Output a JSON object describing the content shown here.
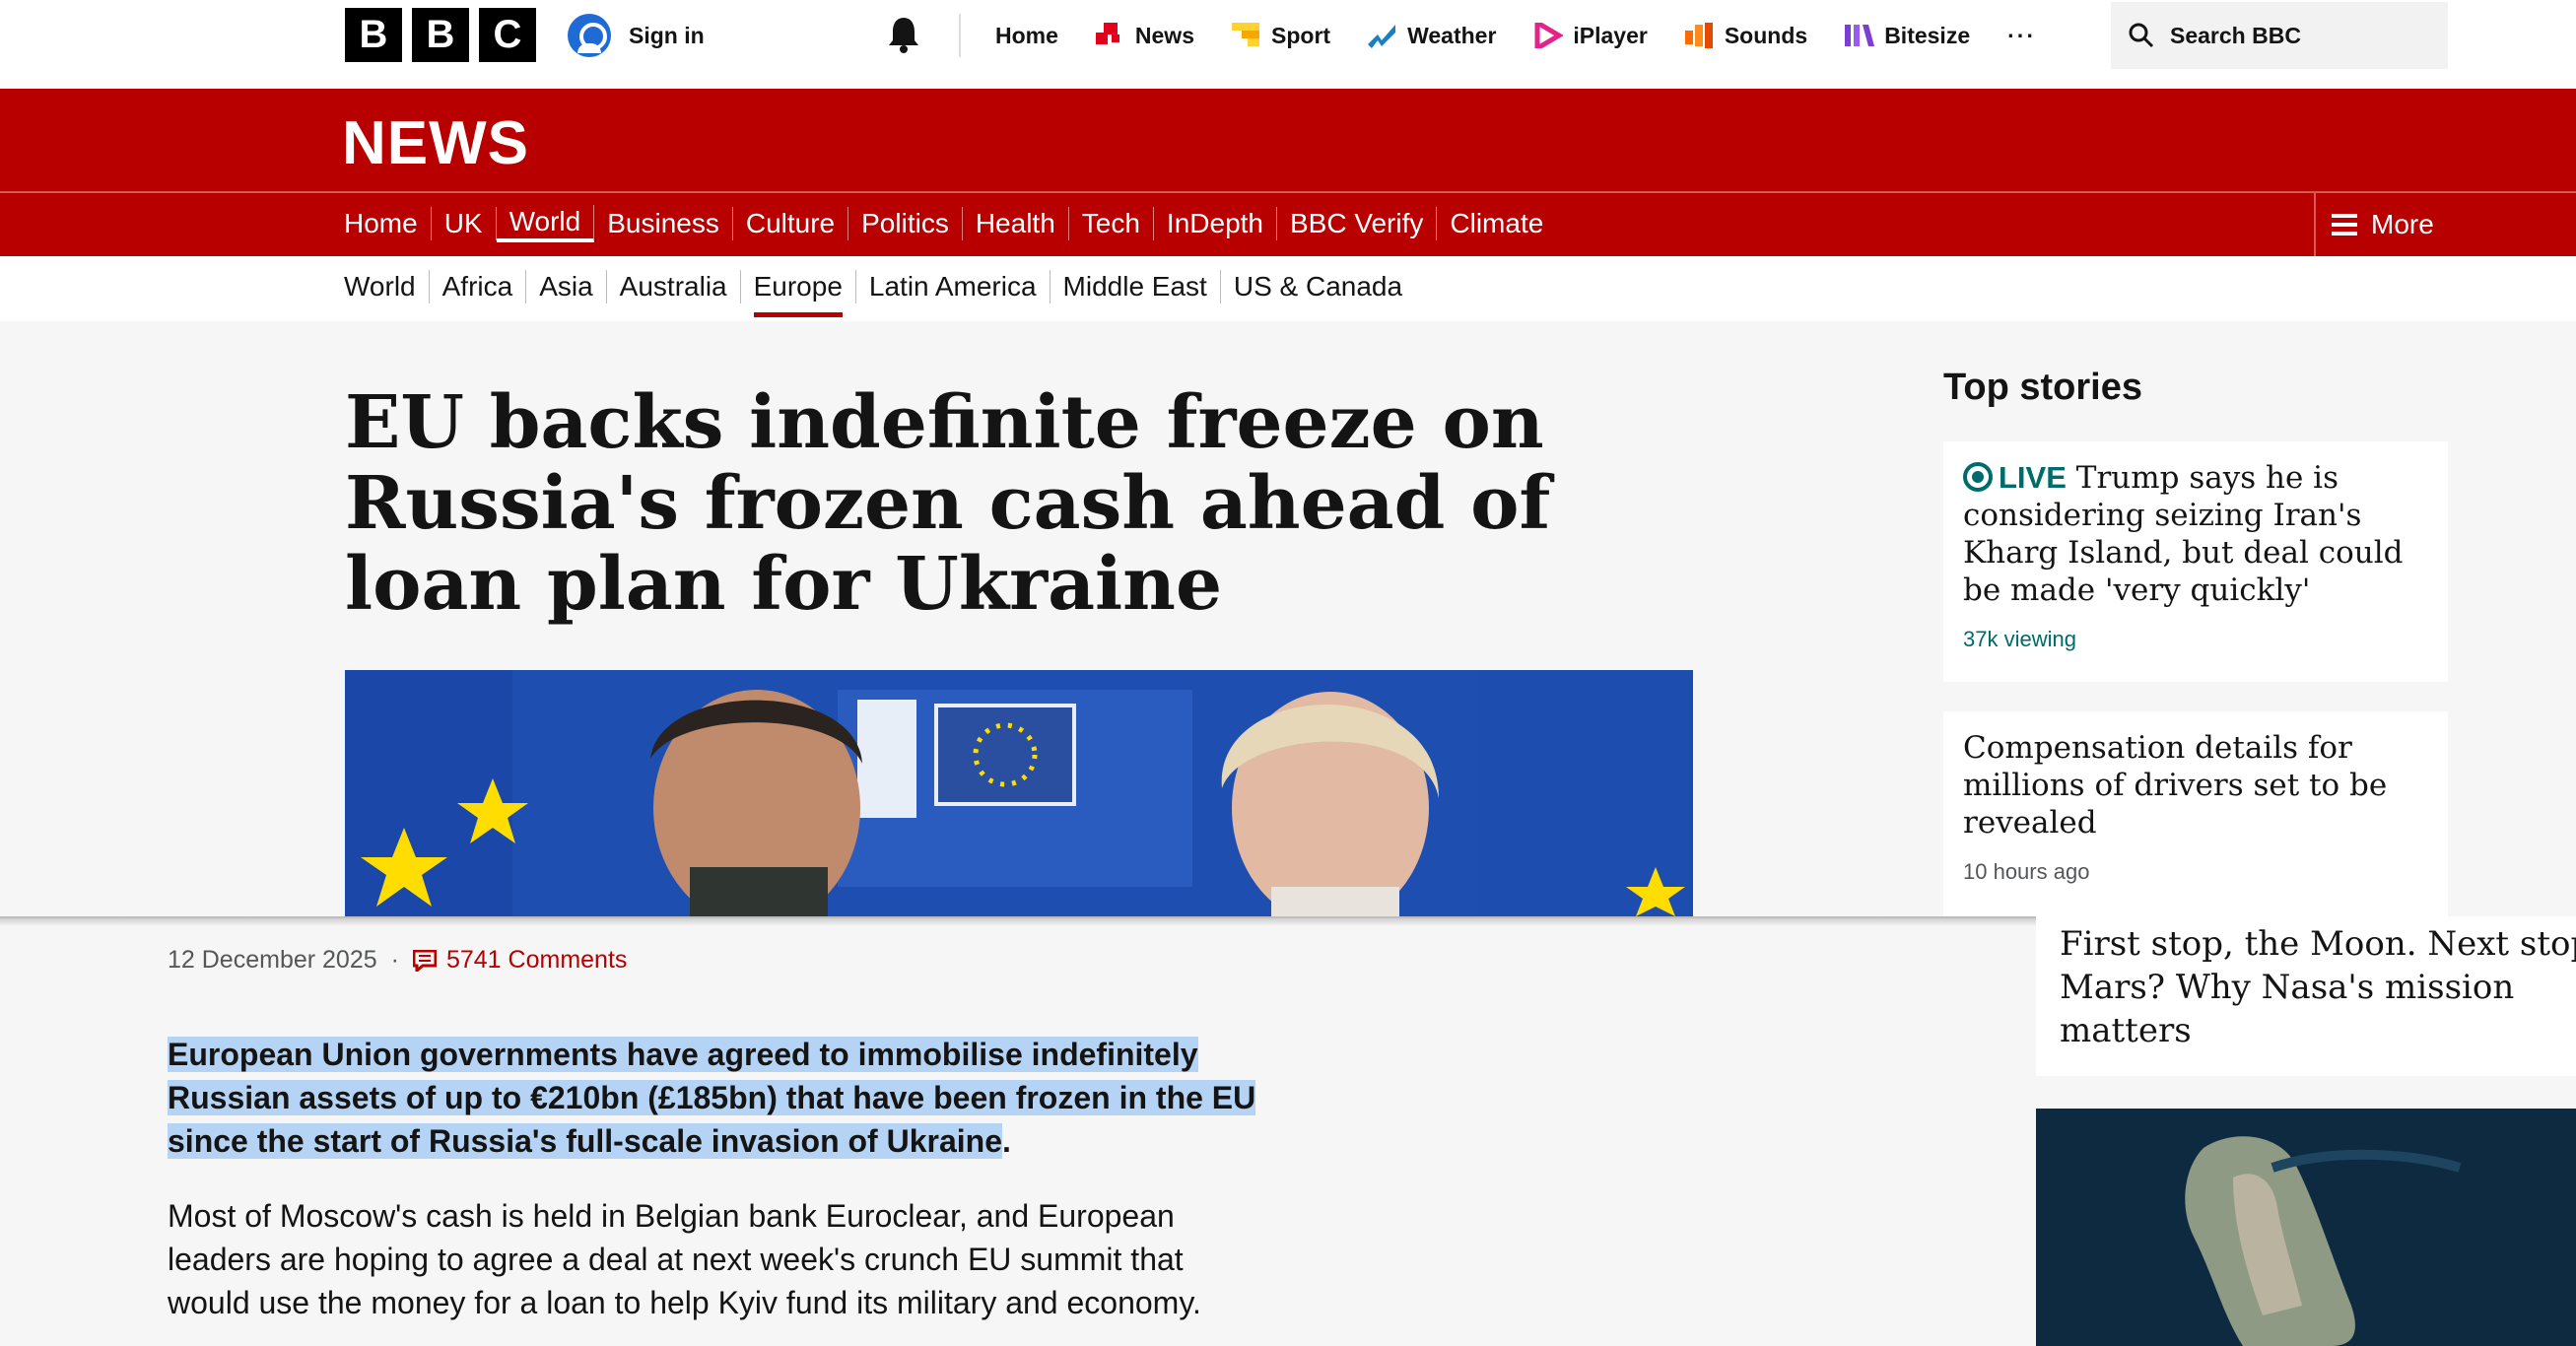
{
  "global_nav": {
    "logo_letters": [
      "B",
      "B",
      "C"
    ],
    "sign_in": "Sign in",
    "items": [
      {
        "label": "Home",
        "icon": "none"
      },
      {
        "label": "News",
        "icon": "news-icon",
        "color": "#e3001b"
      },
      {
        "label": "Sport",
        "icon": "sport-icon",
        "color": "#ffd230"
      },
      {
        "label": "Weather",
        "icon": "weather-icon",
        "color": "#1a7fc1"
      },
      {
        "label": "iPlayer",
        "icon": "iplayer-icon",
        "color": "#e3228a"
      },
      {
        "label": "Sounds",
        "icon": "sounds-icon",
        "color": "#ff6b00"
      },
      {
        "label": "Bitesize",
        "icon": "bitesize-icon",
        "color": "#7b3fd1"
      }
    ],
    "more": "···",
    "search_placeholder": "Search BBC"
  },
  "news_header": {
    "logo": "NEWS",
    "brand_color": "#b80000",
    "sections": [
      "Home",
      "UK",
      "World",
      "Business",
      "Culture",
      "Politics",
      "Health",
      "Tech",
      "InDepth",
      "BBC Verify",
      "Climate"
    ],
    "active_section": "World",
    "more": "More"
  },
  "sub_nav": {
    "items": [
      "World",
      "Africa",
      "Asia",
      "Australia",
      "Europe",
      "Latin America",
      "Middle East",
      "US & Canada"
    ],
    "active": "Europe"
  },
  "article": {
    "headline": "EU backs indefinite freeze on Russia's frozen cash ahead of loan plan for Ukraine",
    "date": "12 December 2025",
    "comments": "5741 Comments",
    "intro_highlighted": "European Union governments have agreed to immobilise indefinitely Russian assets of up to €210bn (£185bn) that have been frozen in the EU since the start of Russia's full-scale invasion of Ukraine",
    "intro_tail": ".",
    "paragraph": "Most of Moscow's cash is held in Belgian bank Euroclear, and European leaders are hoping to agree a deal at next week's crunch EU summit that would use the money for a loan to help Kyiv fund its military and economy."
  },
  "top_stories": {
    "title": "Top stories",
    "stories": [
      {
        "live_label": "LIVE",
        "text": "Trump says he is considering seizing Iran's Kharg Island, but deal could be made 'very quickly'",
        "meta": "37k viewing"
      },
      {
        "text": "Compensation details for millions of drivers set to be revealed",
        "meta": "10 hours ago"
      },
      {
        "text": "First stop, the Moon. Next stop Mars? Why Nasa's mission matters"
      }
    ]
  }
}
